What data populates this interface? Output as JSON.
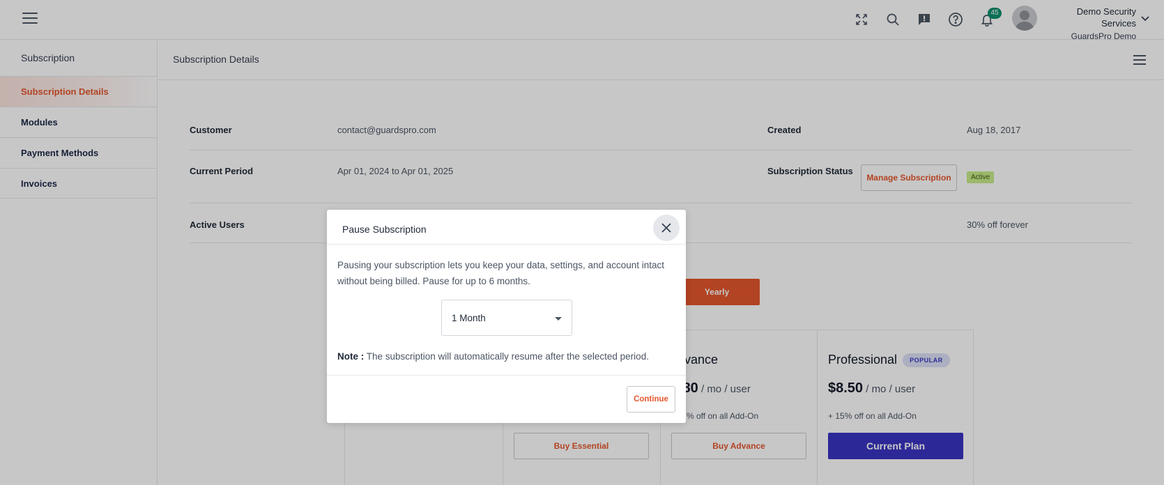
{
  "header": {
    "notification_count": "45",
    "user_name": "Demo Security Services",
    "user_org": "GuardsPro Demo"
  },
  "sidebar": {
    "title": "Subscription",
    "items": [
      {
        "label": "Subscription Details",
        "active": true
      },
      {
        "label": "Modules"
      },
      {
        "label": "Payment Methods"
      },
      {
        "label": "Invoices"
      }
    ]
  },
  "content": {
    "title": "Subscription Details"
  },
  "details": {
    "customer_label": "Customer",
    "customer_value": "contact@guardspro.com",
    "created_label": "Created",
    "created_value": "Aug 18, 2017",
    "period_label": "Current Period",
    "period_value": "Apr 01, 2024 to Apr 01, 2025",
    "status_label": "Subscription Status",
    "status_badge": "Active",
    "manage_button": "Manage Subscription",
    "users_label": "Active Users",
    "discount_value": "30% off forever"
  },
  "billing": {
    "yearly_label": "Yearly"
  },
  "plans": [
    {
      "name": "",
      "price": "",
      "unit": "",
      "addon": "",
      "button": "Buy Essential"
    },
    {
      "name": "vance",
      "price": ".80",
      "unit": " / mo / user",
      "addon": "% off on all Add-On",
      "button": "Buy Advance"
    },
    {
      "name": "Professional",
      "badge": "POPULAR",
      "price": "$8.50",
      "unit": " / mo / user",
      "addon": "+ 15% off on all Add-On",
      "button": "Current Plan"
    }
  ],
  "modal": {
    "title": "Pause Subscription",
    "description": "Pausing your subscription lets you keep your data, settings, and account intact without being billed. Pause for up to 6 months.",
    "select_value": "1 Month",
    "note_label": "Note :",
    "note_text": " The subscription will automatically resume after the selected period.",
    "continue_button": "Continue"
  },
  "colors": {
    "accent": "#e4572e",
    "primary": "#3a34c2",
    "badge_green": "#0d8f6f"
  }
}
